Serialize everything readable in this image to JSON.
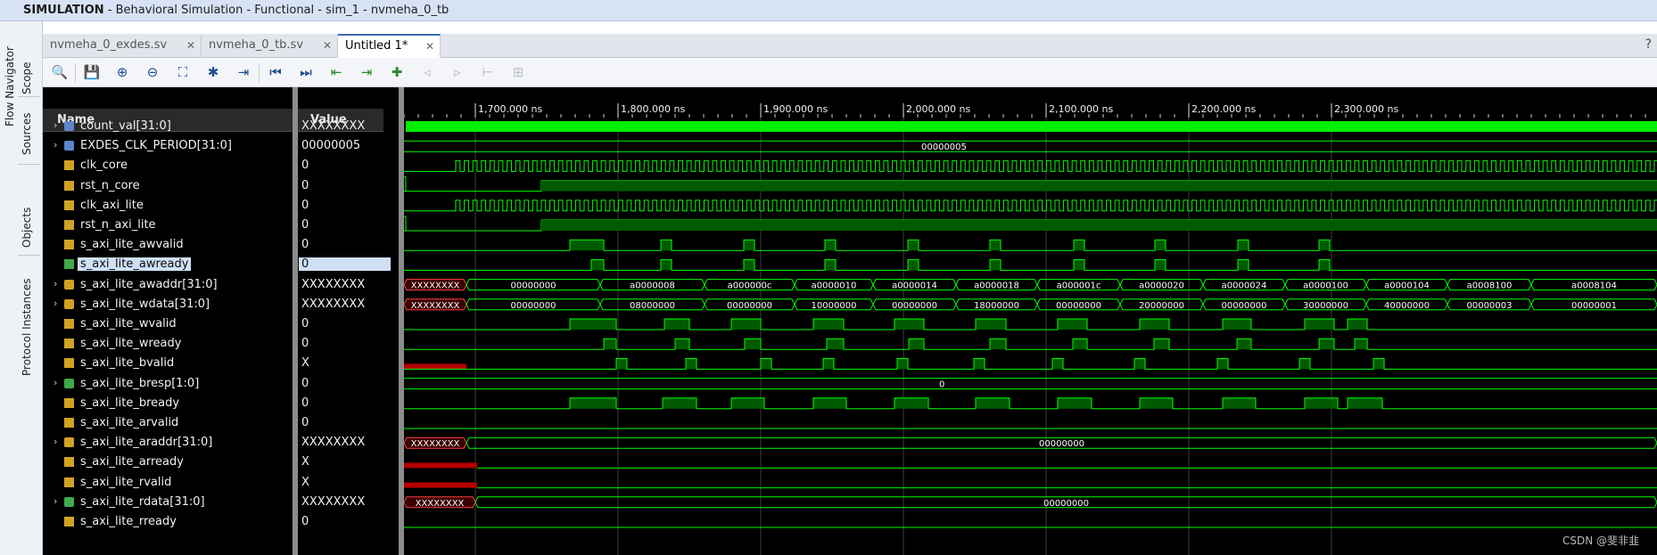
{
  "window": {
    "title_bold": "SIMULATION",
    "title_rest": " - Behavioral Simulation - Functional - sim_1 - nvmeha_0_tb"
  },
  "side_tabs": [
    "Flow Navigator",
    "Scope",
    "Sources",
    "Objects",
    "Protocol Instances"
  ],
  "tabs": [
    {
      "label": "nvmeha_0_exdes.sv",
      "close": "✕",
      "active": false
    },
    {
      "label": "nvmeha_0_tb.sv",
      "close": "✕",
      "active": false
    },
    {
      "label": "Untitled 1*",
      "close": "✕",
      "active": true
    }
  ],
  "help_label": "?",
  "toolbar_icons": [
    {
      "name": "search",
      "glyph": "🔍"
    },
    {
      "name": "save",
      "glyph": "💾"
    },
    {
      "name": "zoom-in",
      "glyph": "⊕"
    },
    {
      "name": "zoom-out",
      "glyph": "⊖"
    },
    {
      "name": "zoom-fit",
      "glyph": "⛶"
    },
    {
      "name": "cursor-marker",
      "glyph": "✱"
    },
    {
      "name": "go-to-cursor",
      "glyph": "⇥"
    },
    {
      "name": "go-to-time-zero",
      "glyph": "⏮"
    },
    {
      "name": "go-to-last-time",
      "glyph": "⏭"
    },
    {
      "name": "previous-transition",
      "glyph": "⇤"
    },
    {
      "name": "next-transition",
      "glyph": "⇥"
    },
    {
      "name": "add-marker",
      "glyph": "✚"
    },
    {
      "name": "previous-marker",
      "glyph": "◃"
    },
    {
      "name": "next-marker",
      "glyph": "▹"
    },
    {
      "name": "swap-cursors",
      "glyph": "⊢"
    },
    {
      "name": "snap",
      "glyph": "⊞"
    }
  ],
  "columns": {
    "name": "Name",
    "value": "Value"
  },
  "signals": [
    {
      "name": "count_val[31:0]",
      "value": "XXXXXXXX",
      "bus": true,
      "kind": "const"
    },
    {
      "name": "EXDES_CLK_PERIOD[31:0]",
      "value": "00000005",
      "bus": true,
      "kind": "const"
    },
    {
      "name": "clk_core",
      "value": "0",
      "bus": false,
      "kind": "in"
    },
    {
      "name": "rst_n_core",
      "value": "0",
      "bus": false,
      "kind": "in"
    },
    {
      "name": "clk_axi_lite",
      "value": "0",
      "bus": false,
      "kind": "in"
    },
    {
      "name": "rst_n_axi_lite",
      "value": "0",
      "bus": false,
      "kind": "in"
    },
    {
      "name": "s_axi_lite_awvalid",
      "value": "0",
      "bus": false,
      "kind": "in"
    },
    {
      "name": "s_axi_lite_awready",
      "value": "0",
      "bus": false,
      "kind": "out",
      "selected": true
    },
    {
      "name": "s_axi_lite_awaddr[31:0]",
      "value": "XXXXXXXX",
      "bus": true,
      "kind": "in"
    },
    {
      "name": "s_axi_lite_wdata[31:0]",
      "value": "XXXXXXXX",
      "bus": true,
      "kind": "in"
    },
    {
      "name": "s_axi_lite_wvalid",
      "value": "0",
      "bus": false,
      "kind": "in"
    },
    {
      "name": "s_axi_lite_wready",
      "value": "0",
      "bus": false,
      "kind": "in"
    },
    {
      "name": "s_axi_lite_bvalid",
      "value": "X",
      "bus": false,
      "kind": "in"
    },
    {
      "name": "s_axi_lite_bresp[1:0]",
      "value": "0",
      "bus": true,
      "kind": "out"
    },
    {
      "name": "s_axi_lite_bready",
      "value": "0",
      "bus": false,
      "kind": "in"
    },
    {
      "name": "s_axi_lite_arvalid",
      "value": "0",
      "bus": false,
      "kind": "in"
    },
    {
      "name": "s_axi_lite_araddr[31:0]",
      "value": "XXXXXXXX",
      "bus": true,
      "kind": "in"
    },
    {
      "name": "s_axi_lite_arready",
      "value": "X",
      "bus": false,
      "kind": "in"
    },
    {
      "name": "s_axi_lite_rvalid",
      "value": "X",
      "bus": false,
      "kind": "in"
    },
    {
      "name": "s_axi_lite_rdata[31:0]",
      "value": "XXXXXXXX",
      "bus": true,
      "kind": "out"
    },
    {
      "name": "s_axi_lite_rready",
      "value": "0",
      "bus": false,
      "kind": "in"
    }
  ],
  "timeline": {
    "labels": [
      "1,700.000 ns",
      "1,800.000 ns",
      "1,900.000 ns",
      "2,000.000 ns",
      "2,100.000 ns",
      "2,200.000 ns",
      "2,300.000 ns"
    ]
  },
  "bus_values": {
    "exdes_clk_period": "00000005",
    "awaddr": [
      "XXXXXXXX",
      "00000000",
      "a0000008",
      "a000000c",
      "a0000010",
      "a0000014",
      "a0000018",
      "a000001c",
      "a0000020",
      "a0000024",
      "a0000100",
      "a0000104",
      "a0008100",
      "a0008104"
    ],
    "wdata": [
      "XXXXXXXX",
      "00000000",
      "08000000",
      "00000000",
      "10000000",
      "00000000",
      "18000000",
      "00000000",
      "20000000",
      "00000000",
      "30000000",
      "40000000",
      "00000003",
      "00000001"
    ],
    "bresp": "0",
    "araddr": [
      "XXXXXXXX",
      "00000000"
    ],
    "rdata": [
      "XXXXXXXX",
      "00000000"
    ]
  },
  "colors": {
    "wave": "#00ff00",
    "wave_fill": "#005a00",
    "unknown": "#b40000",
    "grid": "#3c3c3c",
    "background": "#000000"
  },
  "watermark": "CSDN @斐非韭"
}
